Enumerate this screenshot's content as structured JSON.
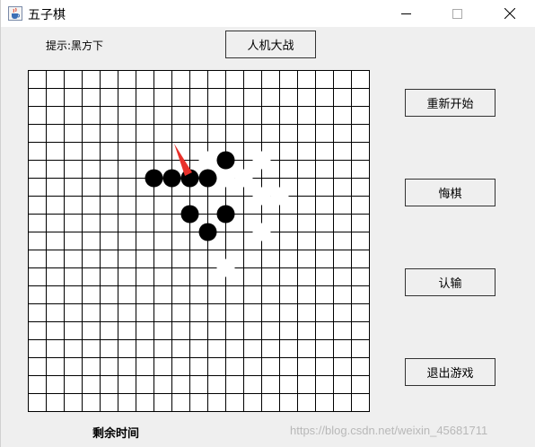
{
  "window": {
    "title": "五子棋",
    "icon": "java-cup-icon"
  },
  "toolbar": {
    "hint": "提示:黑方下",
    "mode_button": "人机大战"
  },
  "side_buttons": {
    "restart": "重新开始",
    "undo": "悔棋",
    "resign": "认输",
    "exit": "退出游戏"
  },
  "board": {
    "columns": 19,
    "rows": 19,
    "black_stones": [
      [
        7,
        6
      ],
      [
        8,
        6
      ],
      [
        9,
        6
      ],
      [
        10,
        6
      ],
      [
        11,
        5
      ],
      [
        9,
        8
      ],
      [
        11,
        8
      ],
      [
        10,
        9
      ]
    ],
    "white_stones": [
      [
        10,
        5
      ],
      [
        13,
        5
      ],
      [
        11,
        6
      ],
      [
        12,
        6
      ],
      [
        13,
        7
      ],
      [
        14,
        7
      ],
      [
        13,
        9
      ],
      [
        11,
        11
      ]
    ],
    "pointer": "red-arrow-cursor"
  },
  "footer": {
    "time_label": "剩余时间",
    "watermark": "https://blog.csdn.net/weixin_45681711"
  },
  "colors": {
    "black_stone": "#000000",
    "white_stone": "#ffffff",
    "arrow": "#e8312b"
  }
}
